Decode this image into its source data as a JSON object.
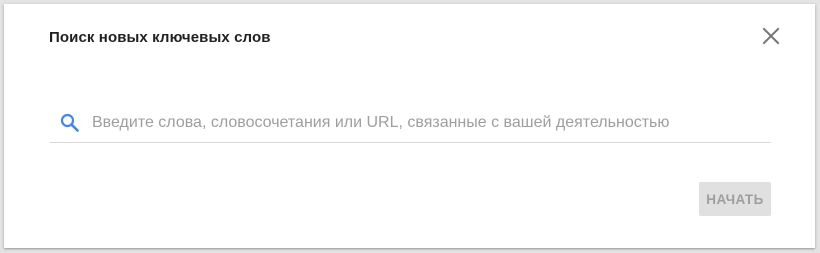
{
  "dialog": {
    "title": "Поиск новых ключевых слов",
    "close_icon": "close-icon",
    "search": {
      "icon": "search-icon",
      "value": "",
      "placeholder": "Введите слова, словосочетания или URL, связанные с вашей деятельностью"
    },
    "start_button": {
      "label": "НАЧАТЬ",
      "enabled": false
    }
  },
  "colors": {
    "accent": "#4285f4",
    "icon_gray": "#757575",
    "button_bg_disabled": "#e0e0e0",
    "button_text_disabled": "#9e9e9e"
  }
}
